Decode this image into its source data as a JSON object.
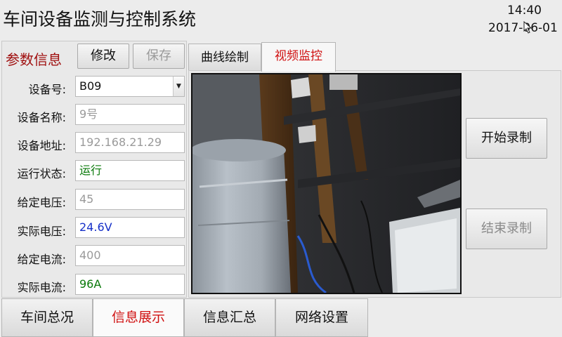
{
  "header": {
    "title": "车间设备监测与控制系统",
    "time": "14:40",
    "date": "2017-06-01"
  },
  "params": {
    "title": "参数信息",
    "edit_label": "修改",
    "save_label": "保存",
    "rows": [
      {
        "label": "设备号:",
        "value": "B09"
      },
      {
        "label": "设备名称:",
        "value": "9号"
      },
      {
        "label": "设备地址:",
        "value": "192.168.21.29"
      },
      {
        "label": "运行状态:",
        "value": "运行"
      },
      {
        "label": "给定电压:",
        "value": "45"
      },
      {
        "label": "实际电压:",
        "value": "24.6V"
      },
      {
        "label": "给定电流:",
        "value": "400"
      },
      {
        "label": "实际电流:",
        "value": "96A"
      }
    ]
  },
  "tabs": [
    {
      "label": "曲线绘制"
    },
    {
      "label": "视频监控"
    }
  ],
  "video": {
    "start_label": "开始录制",
    "stop_label": "结束录制"
  },
  "nav": [
    {
      "label": "车间总况"
    },
    {
      "label": "信息展示"
    },
    {
      "label": "信息汇总"
    },
    {
      "label": "网络设置"
    }
  ],
  "colors": {
    "accent": "#d01010",
    "title_red": "#a01010",
    "status_green": "#0a7a0a",
    "value_blue": "#1630c8"
  }
}
